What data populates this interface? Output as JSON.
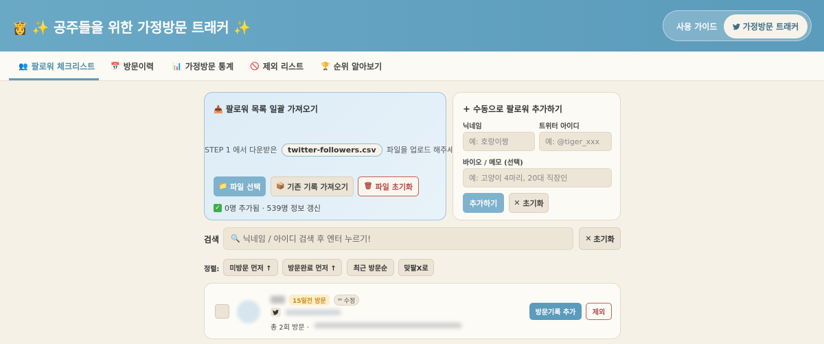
{
  "header": {
    "title_icon": "princess-icon",
    "title": "✨ 공주들을 위한 가정방문 트래커 ✨",
    "guide_label": "사용 가이드",
    "tracker_label": "가정방문 트래커",
    "tracker_icon": "twitter-bird-icon"
  },
  "tabs": [
    {
      "icon": "👥",
      "label": "팔로워 체크리스트",
      "active": true
    },
    {
      "icon": "📅",
      "label": "방문이력"
    },
    {
      "icon": "📊",
      "label": "가정방문 통계"
    },
    {
      "icon": "🚫",
      "label": "제외 리스트"
    },
    {
      "icon": "🏆",
      "label": "순위 알아보기"
    }
  ],
  "import_card": {
    "icon": "📥",
    "title": "팔로워 목록 일괄 가져오기",
    "step_prefix": "STEP 1 에서 다운받은",
    "file_name": "twitter-followers.csv",
    "step_suffix": "파일을 업로드 해주세요!",
    "select_file_label": "파일 선택",
    "import_existing_label": "기존 기록 가져오기",
    "reset_file_label": "파일 초기화",
    "status": "0명 추가됨 · 539명 정보 갱신"
  },
  "manual_card": {
    "title": "수동으로 팔로워 추가하기",
    "nickname_label": "닉네임",
    "nickname_placeholder": "예: 호랑이짱",
    "twitter_id_label": "트위터 아이디",
    "twitter_id_placeholder": "예: @tiger_xxx",
    "bio_label": "바이오 / 메모 (선택)",
    "bio_placeholder": "예: 고양이 4마리, 20대 직장인",
    "add_label": "추가하기",
    "reset_label": "초기화"
  },
  "search": {
    "label": "검색",
    "placeholder": "닉네임 / 아이디 검색 후 엔터 누르기!",
    "reset_label": "초기화"
  },
  "sort": {
    "label": "정렬:",
    "options": [
      "미방문 먼저 ↑",
      "방문완료 먼저 ↑",
      "최근 방문순",
      "맞팔X로"
    ]
  },
  "follower_row": {
    "days_badge": "15일전 방문",
    "edit_label": "수정",
    "visit_count": "총 2회 방문 ·",
    "visit_add_label": "방문기록 추가",
    "exclude_label": "제외"
  },
  "colors": {
    "header": "#5b9bbb",
    "accent": "#5b9bbb",
    "danger": "#c0605a",
    "background": "#f6f1e7"
  }
}
